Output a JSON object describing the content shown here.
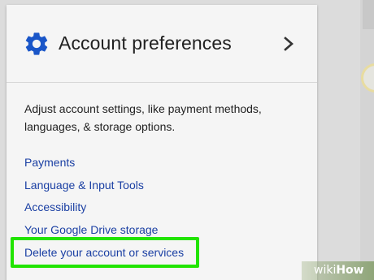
{
  "header": {
    "title": "Account preferences",
    "icon": "gear-icon",
    "chevron_icon": "chevron-right-icon",
    "accent_color": "#1a56c8"
  },
  "description": "Adjust account settings, like payment methods, languages, & storage options.",
  "links": [
    {
      "label": "Payments"
    },
    {
      "label": "Language & Input Tools"
    },
    {
      "label": "Accessibility"
    },
    {
      "label": "Your Google Drive storage"
    },
    {
      "label": "Delete your account or services",
      "highlighted": true
    }
  ],
  "highlight_color": "#22e400",
  "link_color": "#1a3fa3",
  "watermark": {
    "part1": "wiki",
    "part2": "How"
  }
}
